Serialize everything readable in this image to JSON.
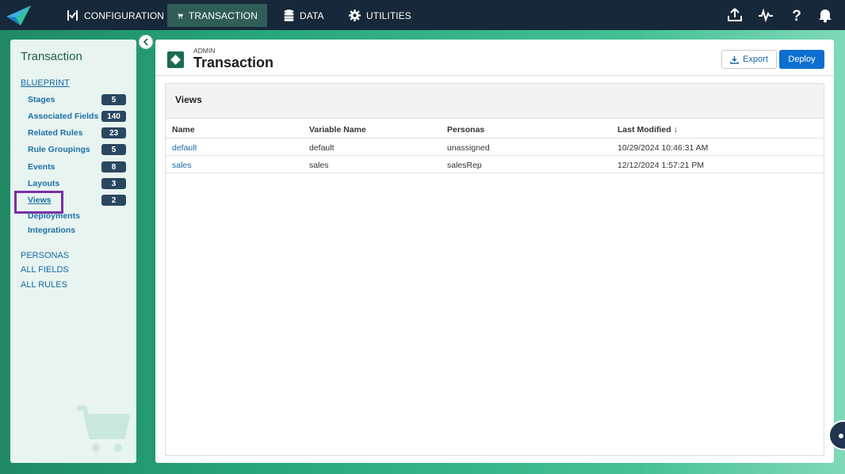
{
  "topnav": {
    "items": [
      {
        "label": "CONFIGURATION",
        "icon": "configuration-icon"
      },
      {
        "label": "TRANSACTION",
        "icon": "cart-icon",
        "active": true
      },
      {
        "label": "DATA",
        "icon": "database-icon"
      },
      {
        "label": "UTILITIES",
        "icon": "gear-icon"
      }
    ],
    "right_icons": [
      "upload-icon",
      "activity-icon",
      "help-icon",
      "bell-icon"
    ]
  },
  "sidebar": {
    "title": "Transaction",
    "blueprint_label": "BLUEPRINT",
    "items": [
      {
        "label": "Stages",
        "count": "5"
      },
      {
        "label": "Associated Fields",
        "count": "140"
      },
      {
        "label": "Related Rules",
        "count": "23"
      },
      {
        "label": "Rule Groupings",
        "count": "5"
      },
      {
        "label": "Events",
        "count": "8"
      },
      {
        "label": "Layouts",
        "count": "3"
      },
      {
        "label": "Views",
        "count": "2",
        "selected": true
      },
      {
        "label": "Deployments"
      },
      {
        "label": "Integrations"
      }
    ],
    "sections": [
      "PERSONAS",
      "ALL FIELDS",
      "ALL RULES"
    ]
  },
  "header": {
    "eyebrow": "ADMIN",
    "title": "Transaction",
    "export_label": "Export",
    "deploy_label": "Deploy"
  },
  "views": {
    "title": "Views",
    "columns": [
      "Name",
      "Variable Name",
      "Personas",
      "Last Modified ↓"
    ],
    "rows": [
      [
        "default",
        "default",
        "unassigned",
        "10/29/2024 10:46:31 AM"
      ],
      [
        "sales",
        "sales",
        "salesRep",
        "12/12/2024 1:57:21 PM"
      ]
    ]
  },
  "colors": {
    "topbar": "#17283a",
    "active_tab": "#2e5e57",
    "accent_blue": "#0b6fd1",
    "badge": "#2a4760",
    "highlight": "#7b2fa6"
  }
}
